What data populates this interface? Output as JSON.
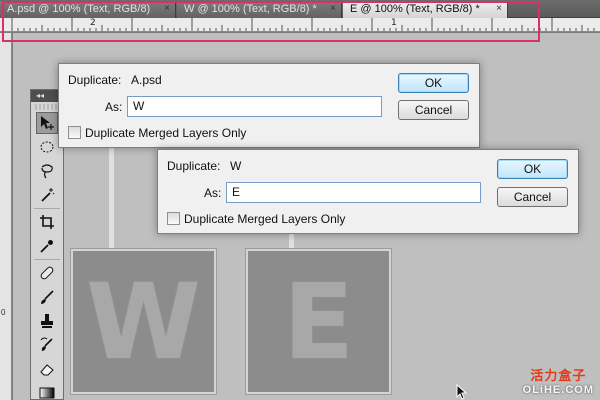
{
  "tabs": [
    {
      "label": "A.psd @ 100% (Text, RGB/8)",
      "active": false
    },
    {
      "label": "W @ 100% (Text, RGB/8) *",
      "active": false
    },
    {
      "label": "E @ 100% (Text, RGB/8) *",
      "active": true
    }
  ],
  "tab_close_glyph": "×",
  "ruler": {
    "labels": [
      "2",
      "1"
    ]
  },
  "left_ruler_label": "0",
  "tools": [
    "move-tool-icon",
    "elliptical-marquee-icon",
    "lasso-icon",
    "magic-wand-icon",
    "crop-icon",
    "eyedropper-icon",
    "healing-brush-icon",
    "brush-icon",
    "clone-stamp-icon",
    "history-brush-icon",
    "eraser-icon",
    "gradient-icon"
  ],
  "dialog_back": {
    "duplicate_label": "Duplicate:",
    "duplicate_value": "A.psd",
    "as_label": "As:",
    "as_value": "W",
    "checkbox_label": "Duplicate Merged Layers Only",
    "ok_label": "OK",
    "cancel_label": "Cancel"
  },
  "dialog_front": {
    "duplicate_label": "Duplicate:",
    "duplicate_value": "W",
    "as_label": "As:",
    "as_value": "E",
    "checkbox_label": "Duplicate Merged Layers Only",
    "ok_label": "OK",
    "cancel_label": "Cancel"
  },
  "canvas_letters": [
    "W",
    "E"
  ],
  "watermark": {
    "chinese": "活力盒子",
    "english": "OLiHE.COM"
  },
  "colors": {
    "highlight": "#d8306e",
    "dialog_bg": "#f0f0f0",
    "default_button": "#bee6fd",
    "letter_tile": "#8c8c8c",
    "watermark_red": "#e53a1a"
  }
}
